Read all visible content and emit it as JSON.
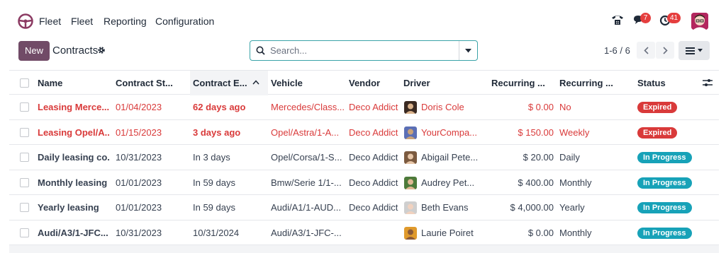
{
  "navbar": {
    "app_name": "Fleet",
    "menu": [
      "Fleet",
      "Reporting",
      "Configuration"
    ],
    "messages_count": "7",
    "activities_count": "41",
    "icons": [
      "phone-icon",
      "chat-icon",
      "clock-icon",
      "user-avatar"
    ]
  },
  "control": {
    "new_label": "New",
    "breadcrumb": "Contracts",
    "search_placeholder": "Search...",
    "pager": "1-6 / 6"
  },
  "table": {
    "columns": [
      "Name",
      "Contract St...",
      "Contract E...",
      "Vehicle",
      "Vendor",
      "Driver",
      "Recurring ...",
      "Recurring ...",
      "Status"
    ],
    "rows": [
      {
        "name": "Leasing Merce...",
        "start": "01/04/2023",
        "end": "62 days ago",
        "vehicle": "Mercedes/Class...",
        "vendor": "Deco Addict",
        "driver": "Doris Cole",
        "cost": "$ 0.00",
        "frequency": "No",
        "status": "Expired",
        "danger": true
      },
      {
        "name": "Leasing Opel/A...",
        "start": "01/15/2023",
        "end": "3 days ago",
        "vehicle": "Opel/Astra/1-A...",
        "vendor": "Deco Addict",
        "driver": "YourCompa...",
        "cost": "$ 150.00",
        "frequency": "Weekly",
        "status": "Expired",
        "danger": true
      },
      {
        "name": "Daily leasing co...",
        "start": "10/31/2023",
        "end": "In 3 days",
        "vehicle": "Opel/Corsa/1-S...",
        "vendor": "Deco Addict",
        "driver": "Abigail Pete...",
        "cost": "$ 20.00",
        "frequency": "Daily",
        "status": "In Progress",
        "danger": false
      },
      {
        "name": "Monthly leasing",
        "start": "01/01/2023",
        "end": "In 59 days",
        "vehicle": "Bmw/Serie 1/1-...",
        "vendor": "Deco Addict",
        "driver": "Audrey Pet...",
        "cost": "$ 400.00",
        "frequency": "Monthly",
        "status": "In Progress",
        "danger": false
      },
      {
        "name": "Yearly leasing",
        "start": "01/01/2023",
        "end": "In 59 days",
        "vehicle": "Audi/A1/1-AUD...",
        "vendor": "Deco Addict",
        "driver": "Beth Evans",
        "cost": "$ 4,000.00",
        "frequency": "Yearly",
        "status": "In Progress",
        "danger": false
      },
      {
        "name": "Audi/A3/1-JFC...",
        "start": "10/31/2023",
        "end": "10/31/2024",
        "vehicle": "Audi/A3/1-JFC-...",
        "vendor": "",
        "driver": "Laurie Poiret",
        "cost": "$ 0.00",
        "frequency": "Monthly",
        "status": "In Progress",
        "danger": false
      }
    ]
  },
  "colors": {
    "primary": "#714b67",
    "danger": "#d93a3a",
    "info": "#17a2b8",
    "search_border": "#3aa3a8"
  }
}
